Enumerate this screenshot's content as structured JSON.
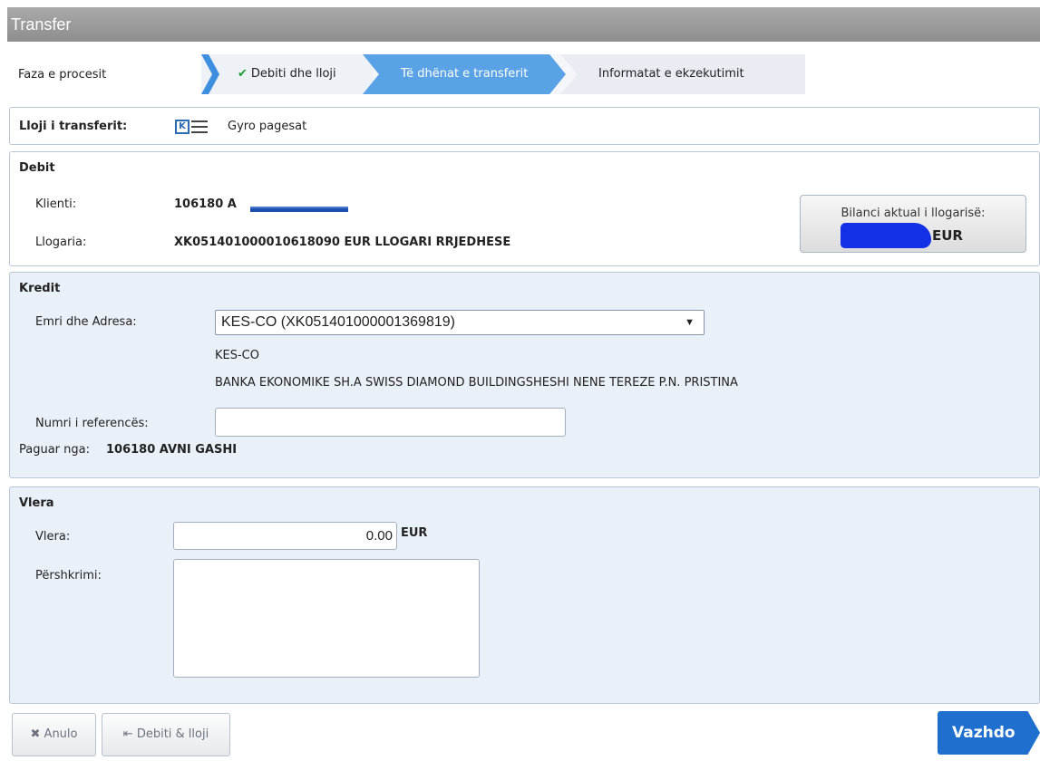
{
  "window": {
    "title": "Transfer"
  },
  "process": {
    "label": "Faza e procesit",
    "steps": [
      "Debiti dhe lloji",
      "Të dhënat e transferit",
      "Informatat e ekzekutimit"
    ]
  },
  "transfer_type": {
    "label": "Lloji i transferit:",
    "value": "Gyro pagesat",
    "icon": "gyro-payment-icon"
  },
  "debit": {
    "title": "Debit",
    "client_label": "Klienti:",
    "client_value": "106180 A",
    "account_label": "Llogaria:",
    "account_value": "XK051401000010618090 EUR LLOGARI RRJEDHESE",
    "balance_label": "Bilanci aktual i llogarisë:",
    "balance_currency": "EUR"
  },
  "kredit": {
    "title": "Kredit",
    "name_label": "Emri dhe Adresa:",
    "name_selected": "KES-CO (XK051401000001369819)",
    "address_line1": "KES-CO",
    "address_line2": "BANKA EKONOMIKE SH.A SWISS DIAMOND BUILDINGSHESHI NENE TEREZE P.N. PRISTINA",
    "reference_label": "Numri i referencës:",
    "reference_value": "",
    "paid_by_label": "Paguar nga:",
    "paid_by_value": "106180 AVNI GASHI"
  },
  "vlera": {
    "title": "Vlera",
    "amount_label": "Vlera:",
    "amount_value": "0.00",
    "currency": "EUR",
    "description_label": "Përshkrimi:",
    "description_value": ""
  },
  "buttons": {
    "cancel": "Anulo",
    "back": "Debiti & lloji",
    "next": "Vazhdo"
  },
  "colors": {
    "accent": "#1f6fce",
    "active_step": "#5aa2e6",
    "section_bg": "#eaf0f8"
  }
}
